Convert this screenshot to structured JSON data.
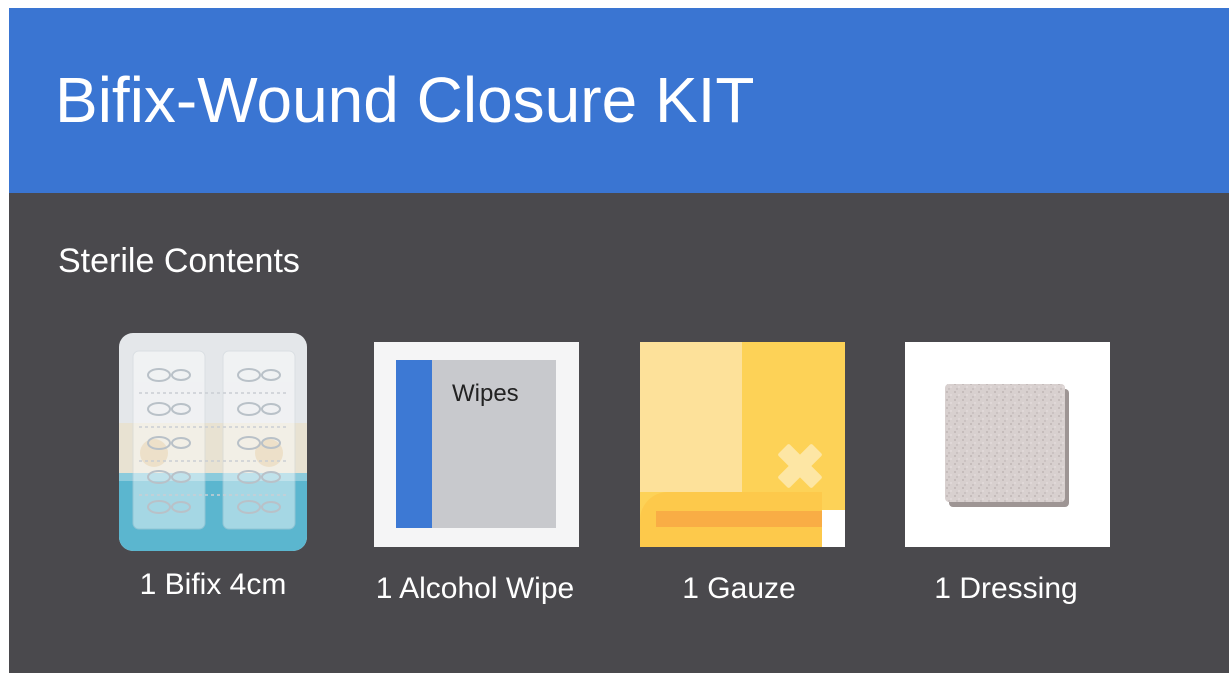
{
  "header": {
    "title": "Bifix-Wound Closure KIT"
  },
  "section": {
    "title": "Sterile Contents"
  },
  "items": [
    {
      "label": "1 Bifix 4cm",
      "icon": "bifix-closure-strips-icon"
    },
    {
      "label": "1 Alcohol Wipe",
      "icon": "alcohol-wipe-icon",
      "image_text": "Wipes"
    },
    {
      "label": "1 Gauze",
      "icon": "gauze-icon"
    },
    {
      "label": "1 Dressing",
      "icon": "dressing-icon"
    }
  ],
  "colors": {
    "header_bg": "#3a75d2",
    "body_bg": "#4a494d",
    "text": "#ffffff"
  }
}
